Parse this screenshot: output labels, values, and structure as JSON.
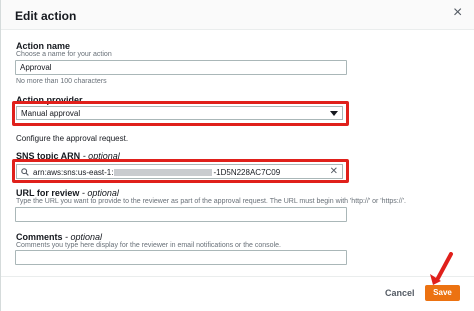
{
  "dialog": {
    "title": "Edit action",
    "close_icon": "close-icon"
  },
  "action_name": {
    "label": "Action name",
    "hint": "Choose a name for your action",
    "value": "Approval",
    "constraint": "No more than 100 characters"
  },
  "action_provider": {
    "label": "Action provider",
    "value": "Manual approval",
    "caret_icon": "caret-down-icon"
  },
  "approval": {
    "intro": "Configure the approval request."
  },
  "sns": {
    "label": "SNS topic ARN",
    "label_suffix": "- optional",
    "prefix": "arn:aws:sns:us-east-1:",
    "suffix": "-1D5N228AC7C09",
    "search_icon": "search-icon",
    "clear_icon": "clear-icon"
  },
  "review_url": {
    "label": "URL for review",
    "label_suffix": "- optional",
    "hint": "Type the URL you want to provide to the reviewer as part of the approval request. The URL must begin with 'http://' or 'https://'.",
    "value": ""
  },
  "comments": {
    "label": "Comments",
    "label_suffix": "- optional",
    "hint": "Comments you type here display for the reviewer in email notifications or the console.",
    "value": ""
  },
  "footer": {
    "cancel_label": "Cancel",
    "save_label": "Save"
  },
  "annotations": {
    "highlight_color": "#e0201b",
    "arrow_icon": "red-arrow-icon"
  },
  "colors": {
    "primary": "#ec7211"
  }
}
